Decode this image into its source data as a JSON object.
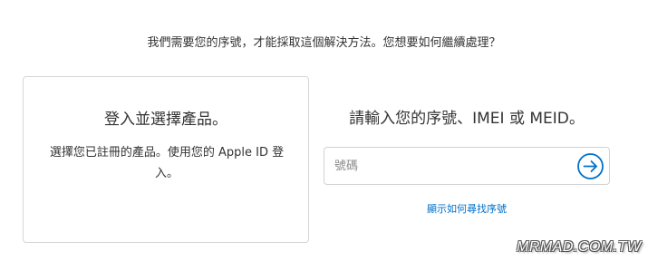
{
  "prompt": "我們需要您的序號，才能採取這個解決方法。您想要如何繼續處理？",
  "signin_card": {
    "title": "登入並選擇產品。",
    "description": "選擇您已註冊的產品。使用您的 Apple ID 登入。"
  },
  "serial": {
    "title": "請輸入您的序號、IMEI 或 MEID。",
    "placeholder": "號碼",
    "value": "",
    "submit_icon": "arrow-right-circle-icon",
    "help_link": "顯示如何尋找序號"
  },
  "watermark": "MRMAD.COM.TW",
  "colors": {
    "accent": "#0070c9",
    "text": "#333333",
    "border": "#d6d6d6"
  }
}
